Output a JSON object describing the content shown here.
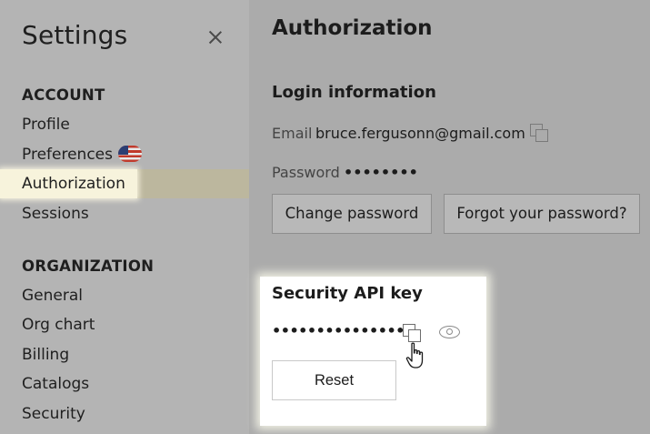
{
  "sidebar": {
    "title": "Settings",
    "sections": [
      {
        "heading": "ACCOUNT",
        "items": [
          "Profile",
          "Preferences",
          "Authorization",
          "Sessions"
        ]
      },
      {
        "heading": "ORGANIZATION",
        "items": [
          "General",
          "Org chart",
          "Billing",
          "Catalogs",
          "Security"
        ]
      }
    ],
    "active_item": "Authorization",
    "preferences_flag_icon": "us-flag-icon"
  },
  "main": {
    "title": "Authorization",
    "login": {
      "heading": "Login information",
      "email_label": "Email",
      "email_value": "bruce.fergusonn@gmail.com",
      "password_label": "Password",
      "password_value": "••••••••",
      "change_password_label": "Change password",
      "forgot_password_label": "Forgot your password?"
    },
    "api_key": {
      "heading": "Security API key",
      "masked_value": "•••••••••••••••••",
      "reset_label": "Reset"
    }
  },
  "colors": {
    "overlay_gray": "#ababab",
    "active_chip": "#f7f3dc",
    "card_bg": "#ffffff"
  }
}
